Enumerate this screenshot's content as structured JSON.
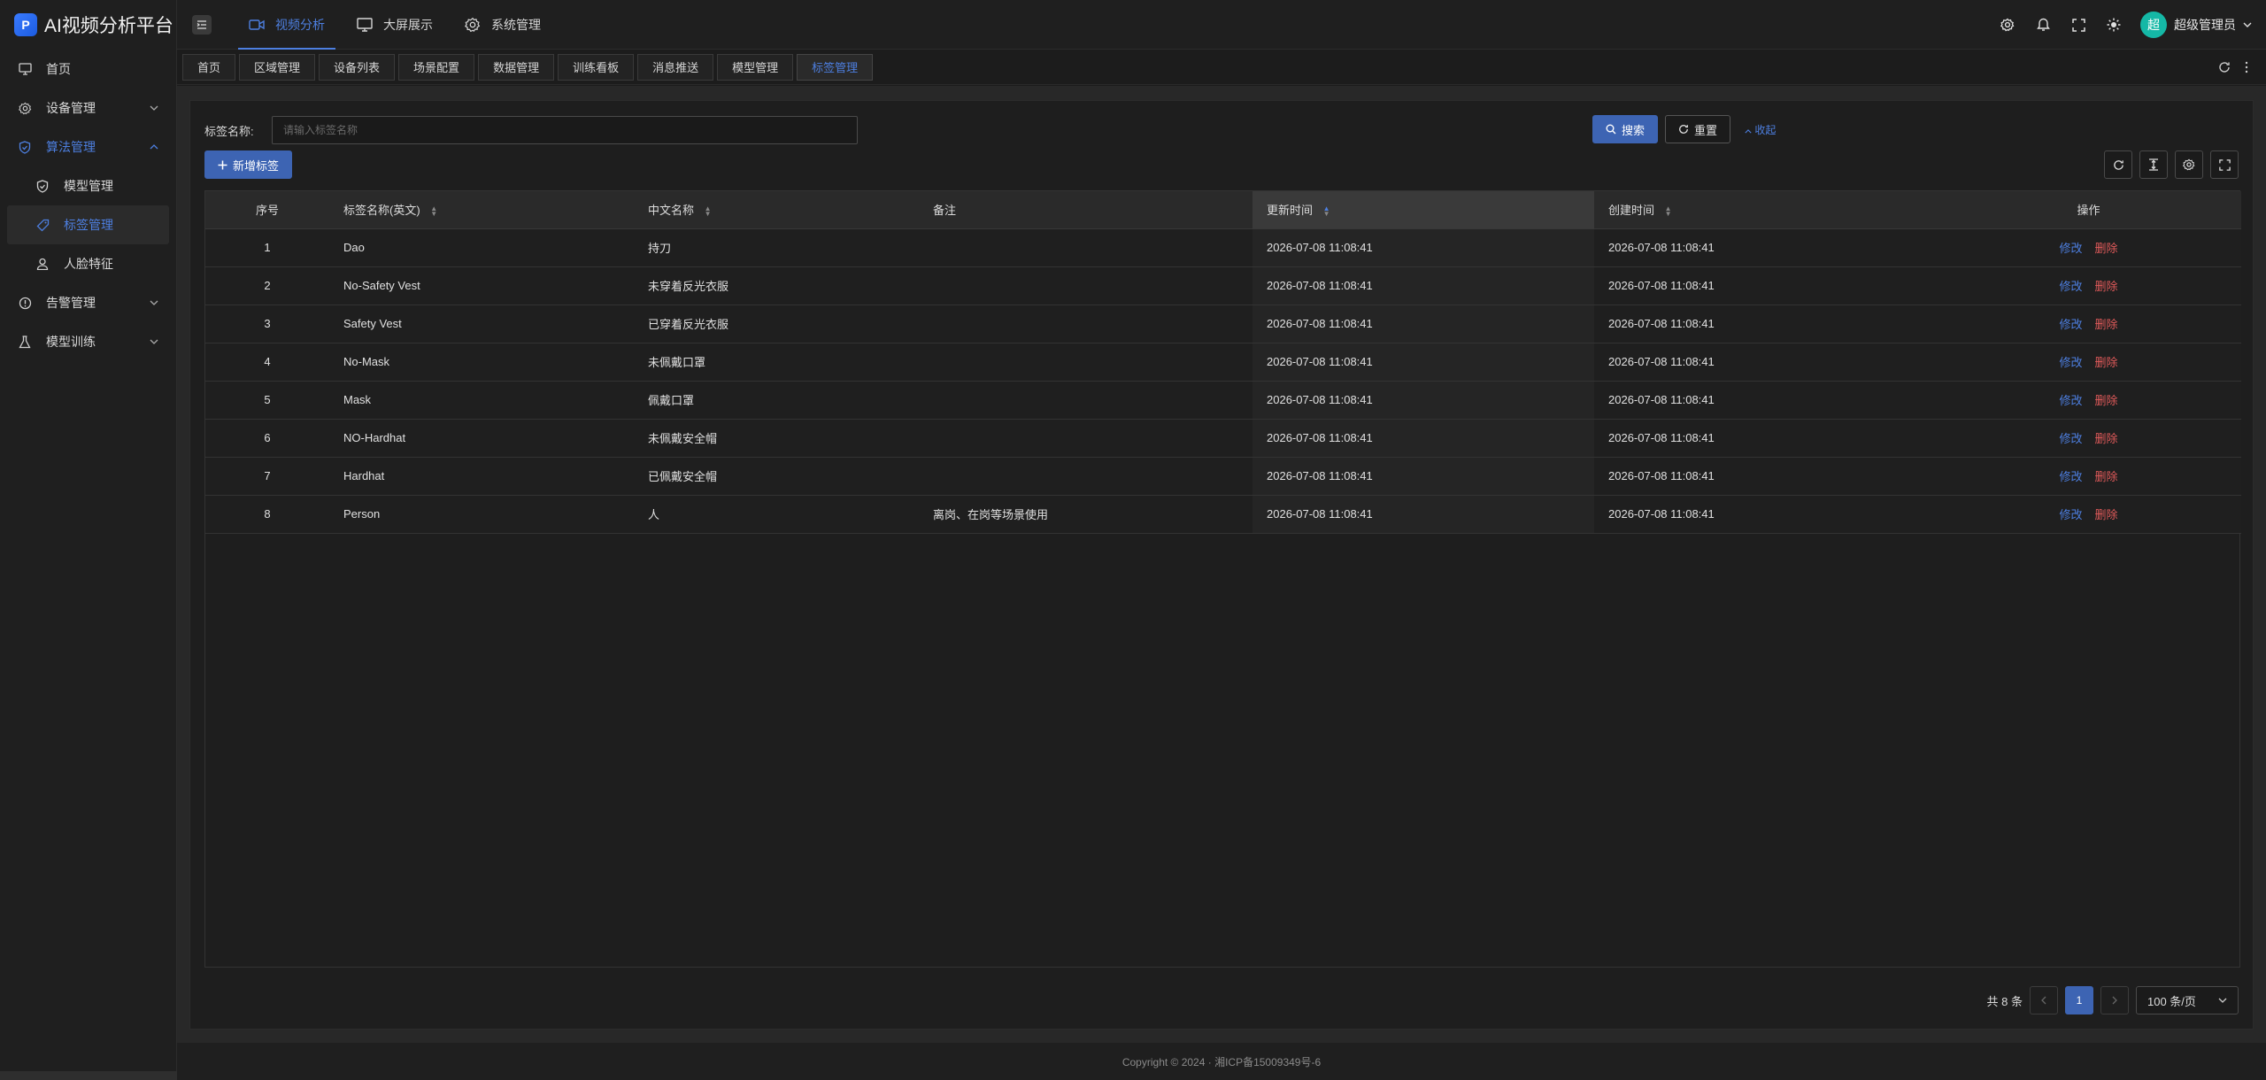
{
  "app": {
    "title": "AI视频分析平台",
    "logo_glyph": "P"
  },
  "sidebar": {
    "items": [
      {
        "label": "首页",
        "icon": "monitor-icon"
      },
      {
        "label": "设备管理",
        "icon": "gear-icon"
      },
      {
        "label": "算法管理",
        "icon": "shield-icon"
      },
      {
        "label": "模型管理",
        "icon": "shield-check-icon"
      },
      {
        "label": "标签管理",
        "icon": "tag-icon"
      },
      {
        "label": "人脸特征",
        "icon": "user-icon"
      },
      {
        "label": "告警管理",
        "icon": "alert-circle-icon"
      },
      {
        "label": "模型训练",
        "icon": "flask-icon"
      }
    ]
  },
  "header": {
    "nav": [
      {
        "label": "视频分析",
        "icon": "video-icon"
      },
      {
        "label": "大屏展示",
        "icon": "monitor-icon"
      },
      {
        "label": "系统管理",
        "icon": "gear-icon"
      }
    ],
    "avatar_char": "超",
    "user_name": "超级管理员"
  },
  "tabs": [
    "首页",
    "区域管理",
    "设备列表",
    "场景配置",
    "数据管理",
    "训练看板",
    "消息推送",
    "模型管理",
    "标签管理"
  ],
  "search": {
    "label": "标签名称:",
    "placeholder": "请输入标签名称",
    "search_btn": "搜索",
    "reset_btn": "重置",
    "collapse": "收起"
  },
  "toolbar": {
    "add_btn": "新增标签"
  },
  "table": {
    "columns": [
      "序号",
      "标签名称(英文)",
      "中文名称",
      "备注",
      "更新时间",
      "创建时间",
      "操作"
    ],
    "rows": [
      {
        "idx": "1",
        "en": "Dao",
        "cn": "持刀",
        "note": "",
        "updated": "2026-07-08 11:08:41",
        "created": "2026-07-08 11:08:41"
      },
      {
        "idx": "2",
        "en": "No-Safety Vest",
        "cn": "未穿着反光衣服",
        "note": "",
        "updated": "2026-07-08 11:08:41",
        "created": "2026-07-08 11:08:41"
      },
      {
        "idx": "3",
        "en": "Safety Vest",
        "cn": "已穿着反光衣服",
        "note": "",
        "updated": "2026-07-08 11:08:41",
        "created": "2026-07-08 11:08:41"
      },
      {
        "idx": "4",
        "en": "No-Mask",
        "cn": "未佩戴口罩",
        "note": "",
        "updated": "2026-07-08 11:08:41",
        "created": "2026-07-08 11:08:41"
      },
      {
        "idx": "5",
        "en": "Mask",
        "cn": "佩戴口罩",
        "note": "",
        "updated": "2026-07-08 11:08:41",
        "created": "2026-07-08 11:08:41"
      },
      {
        "idx": "6",
        "en": "NO-Hardhat",
        "cn": "未佩戴安全帽",
        "note": "",
        "updated": "2026-07-08 11:08:41",
        "created": "2026-07-08 11:08:41"
      },
      {
        "idx": "7",
        "en": "Hardhat",
        "cn": "已佩戴安全帽",
        "note": "",
        "updated": "2026-07-08 11:08:41",
        "created": "2026-07-08 11:08:41"
      },
      {
        "idx": "8",
        "en": "Person",
        "cn": "人",
        "note": "离岗、在岗等场景使用",
        "updated": "2026-07-08 11:08:41",
        "created": "2026-07-08 11:08:41"
      }
    ],
    "edit_label": "修改",
    "delete_label": "删除"
  },
  "pagination": {
    "total": "共 8 条",
    "current": "1",
    "page_size": "100 条/页"
  },
  "footer": {
    "copyright": "Copyright © 2024 · 湘ICP备15009349号-6"
  },
  "colors": {
    "accent": "#4d7fe0",
    "primary_btn": "#3d64b3",
    "danger": "#e05a5a",
    "avatar": "#15b8a6"
  }
}
